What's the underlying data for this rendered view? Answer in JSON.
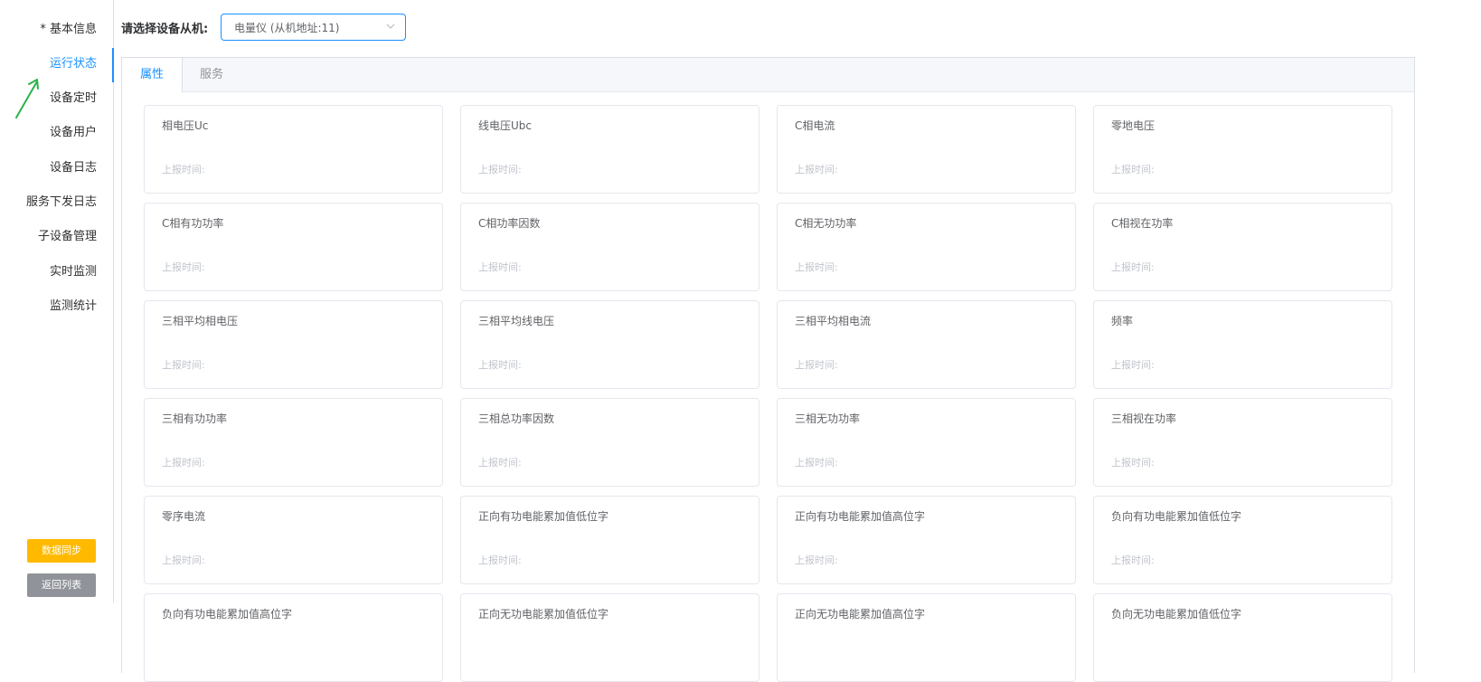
{
  "sidebar": {
    "items": [
      {
        "label": "* 基本信息",
        "active": false
      },
      {
        "label": "运行状态",
        "active": true
      },
      {
        "label": "设备定时",
        "active": false
      },
      {
        "label": "设备用户",
        "active": false
      },
      {
        "label": "设备日志",
        "active": false
      },
      {
        "label": "服务下发日志",
        "active": false
      },
      {
        "label": "子设备管理",
        "active": false
      },
      {
        "label": "实时监测",
        "active": false
      },
      {
        "label": "监测统计",
        "active": false
      }
    ],
    "sync_button": "数据同步",
    "back_button": "返回列表"
  },
  "device_select": {
    "label": "请选择设备从机:",
    "value": "电量仪  (从机地址:11)"
  },
  "tabs": [
    {
      "label": "属性",
      "active": true
    },
    {
      "label": "服务",
      "active": false
    }
  ],
  "cards": [
    {
      "name": "相电压Uc",
      "time_label": "上报时间:"
    },
    {
      "name": "线电压Ubc",
      "time_label": "上报时间:"
    },
    {
      "name": "C相电流",
      "time_label": "上报时间:"
    },
    {
      "name": "零地电压",
      "time_label": "上报时间:"
    },
    {
      "name": "C相有功功率",
      "time_label": "上报时间:"
    },
    {
      "name": "C相功率因数",
      "time_label": "上报时间:"
    },
    {
      "name": "C相无功功率",
      "time_label": "上报时间:"
    },
    {
      "name": "C相视在功率",
      "time_label": "上报时间:"
    },
    {
      "name": "三相平均相电压",
      "time_label": "上报时间:"
    },
    {
      "name": "三相平均线电压",
      "time_label": "上报时间:"
    },
    {
      "name": "三相平均相电流",
      "time_label": "上报时间:"
    },
    {
      "name": "频率",
      "time_label": "上报时间:"
    },
    {
      "name": "三相有功功率",
      "time_label": "上报时间:"
    },
    {
      "name": "三相总功率因数",
      "time_label": "上报时间:"
    },
    {
      "name": "三相无功功率",
      "time_label": "上报时间:"
    },
    {
      "name": "三相视在功率",
      "time_label": "上报时间:"
    },
    {
      "name": "零序电流",
      "time_label": "上报时间:"
    },
    {
      "name": "正向有功电能累加值低位字",
      "time_label": "上报时间:"
    },
    {
      "name": "正向有功电能累加值高位字",
      "time_label": "上报时间:"
    },
    {
      "name": "负向有功电能累加值低位字",
      "time_label": "上报时间:"
    },
    {
      "name": "负向有功电能累加值高位字",
      "time_label": ""
    },
    {
      "name": "正向无功电能累加值低位字",
      "time_label": ""
    },
    {
      "name": "正向无功电能累加值高位字",
      "time_label": ""
    },
    {
      "name": "负向无功电能累加值低位字",
      "time_label": ""
    }
  ],
  "colors": {
    "accent": "#1890ff",
    "sync_button": "#ffba00",
    "back_button": "#909399",
    "annotation_arrow": "#2bb34a"
  }
}
